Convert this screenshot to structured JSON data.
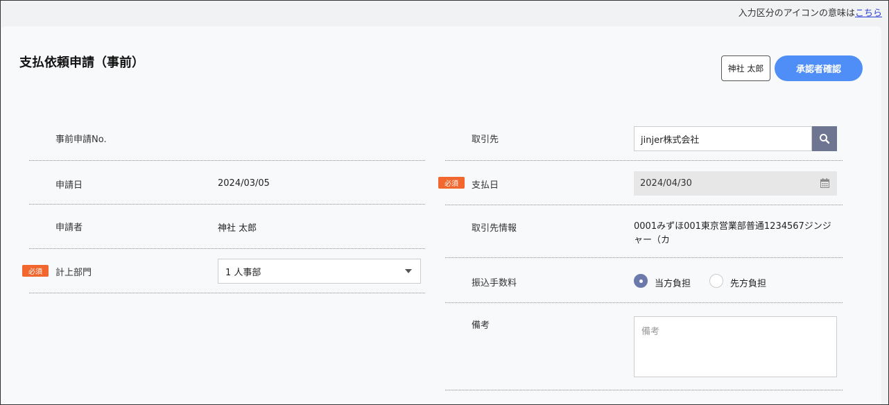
{
  "top_note": {
    "text": "入力区分のアイコンの意味は",
    "link": "こちら"
  },
  "header": {
    "title": "支払依頼申請（事前）",
    "user_button": "神社 太郎",
    "approver_button": "承認者確認"
  },
  "required_label": "必須",
  "left": {
    "pre_app_no": {
      "label": "事前申請No.",
      "value": ""
    },
    "app_date": {
      "label": "申請日",
      "value": "2024/03/05"
    },
    "applicant": {
      "label": "申請者",
      "value": "神社 太郎"
    },
    "department": {
      "label": "計上部門",
      "value": "1 人事部"
    }
  },
  "right": {
    "partner": {
      "label": "取引先",
      "value": "jinjer株式会社"
    },
    "pay_date": {
      "label": "支払日",
      "value": "2024/04/30"
    },
    "partner_info": {
      "label": "取引先情報",
      "line1": "0001みずほ001東京営業部普通1234567ジンジ",
      "line2": "ャー（カ"
    },
    "fee": {
      "label": "振込手数料",
      "option1": "当方負担",
      "option2": "先方負担",
      "selected": "当方負担"
    },
    "notes": {
      "label": "備考",
      "placeholder": "備考"
    }
  },
  "icons": {
    "search": "search-icon",
    "calendar": "calendar-icon",
    "dropdown": "chevron-down-icon"
  },
  "colors": {
    "accent": "#4f8ef7",
    "required": "#f2672d",
    "search_button": "#6e7591",
    "radio_checked": "#6c7aab",
    "link": "#2b3fd6"
  }
}
